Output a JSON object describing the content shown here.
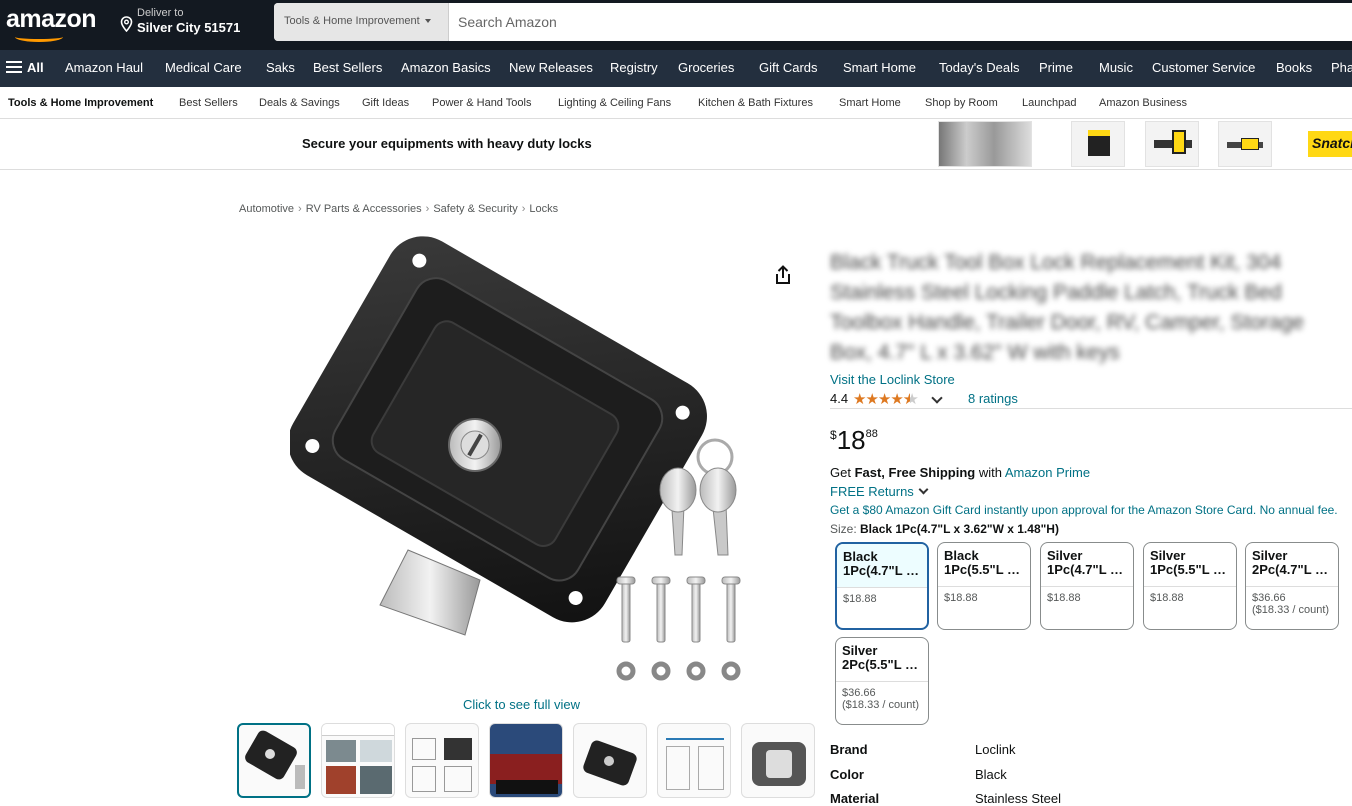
{
  "header": {
    "logo": "amazon",
    "deliver_line1": "Deliver to",
    "deliver_line2": "Silver City 51571",
    "search_category": "Tools & Home Improvement",
    "search_placeholder": "Search Amazon"
  },
  "nav": {
    "all_label": "All",
    "items": [
      "Amazon Haul",
      "Medical Care",
      "Saks",
      "Best Sellers",
      "Amazon Basics",
      "New Releases",
      "Registry",
      "Groceries",
      "Gift Cards",
      "Smart Home",
      "Today's Deals",
      "Prime",
      "Music",
      "Customer Service",
      "Books",
      "Pha"
    ]
  },
  "subnav": {
    "items": [
      "Tools & Home Improvement",
      "Best Sellers",
      "Deals & Savings",
      "Gift Ideas",
      "Power & Hand Tools",
      "Lighting & Ceiling Fans",
      "Kitchen & Bath Fixtures",
      "Smart Home",
      "Shop by Room",
      "Launchpad",
      "Amazon Business"
    ]
  },
  "banner": {
    "text": "Secure your equipments with heavy duty locks",
    "brand_logo": "Snatch"
  },
  "breadcrumb": [
    "Automotive",
    "RV Parts & Accessories",
    "Safety & Security",
    "Locks"
  ],
  "media": {
    "full_view_label": "Click to see full view",
    "thumbnail_count": 7
  },
  "product": {
    "title": "Black Truck Tool Box Lock Replacement Kit, 304 Stainless Steel Locking Paddle Latch, Truck Bed Toolbox Handle, Trailer Door, RV, Camper, Storage Box, 4.7\" L x 3.62\" W with keys",
    "store_link": "Visit the Loclink Store",
    "rating": "4.4",
    "rating_value": 4.4,
    "ratings_count": "8 ratings",
    "price_symbol": "$",
    "price_whole": "18",
    "price_fraction": "88",
    "shipping_prefix": "Get ",
    "shipping_bold": "Fast, Free Shipping",
    "shipping_mid": " with ",
    "shipping_link": "Amazon Prime",
    "returns": "FREE Returns",
    "promo": "Get a $80 Amazon Gift Card instantly upon approval for the Amazon Store Card. No annual fee.",
    "size_label": "Size: ",
    "size_selected": "Black 1Pc(4.7\"L x 3.62\"W x 1.48\"H)"
  },
  "options": [
    {
      "name": "Black 1Pc(4.7\"L …",
      "price": "$18.88",
      "unit": ""
    },
    {
      "name": "Black 1Pc(5.5\"L …",
      "price": "$18.88",
      "unit": ""
    },
    {
      "name": "Silver 1Pc(4.7\"L …",
      "price": "$18.88",
      "unit": ""
    },
    {
      "name": "Silver 1Pc(5.5\"L …",
      "price": "$18.88",
      "unit": ""
    },
    {
      "name": "Silver 2Pc(4.7\"L …",
      "price": "$36.66",
      "unit": "($18.33 / count)"
    },
    {
      "name": "Silver 2Pc(5.5\"L …",
      "price": "$36.66",
      "unit": "($18.33 / count)"
    }
  ],
  "specs": [
    {
      "key": "Brand",
      "value": "Loclink"
    },
    {
      "key": "Color",
      "value": "Black"
    },
    {
      "key": "Material",
      "value": "Stainless Steel"
    }
  ],
  "colors": {
    "header_bg": "#131921",
    "nav_bg": "#232f3e",
    "link": "#007185",
    "accent": "#ff9900",
    "star": "#de7921",
    "selected_border": "#2162a1"
  }
}
